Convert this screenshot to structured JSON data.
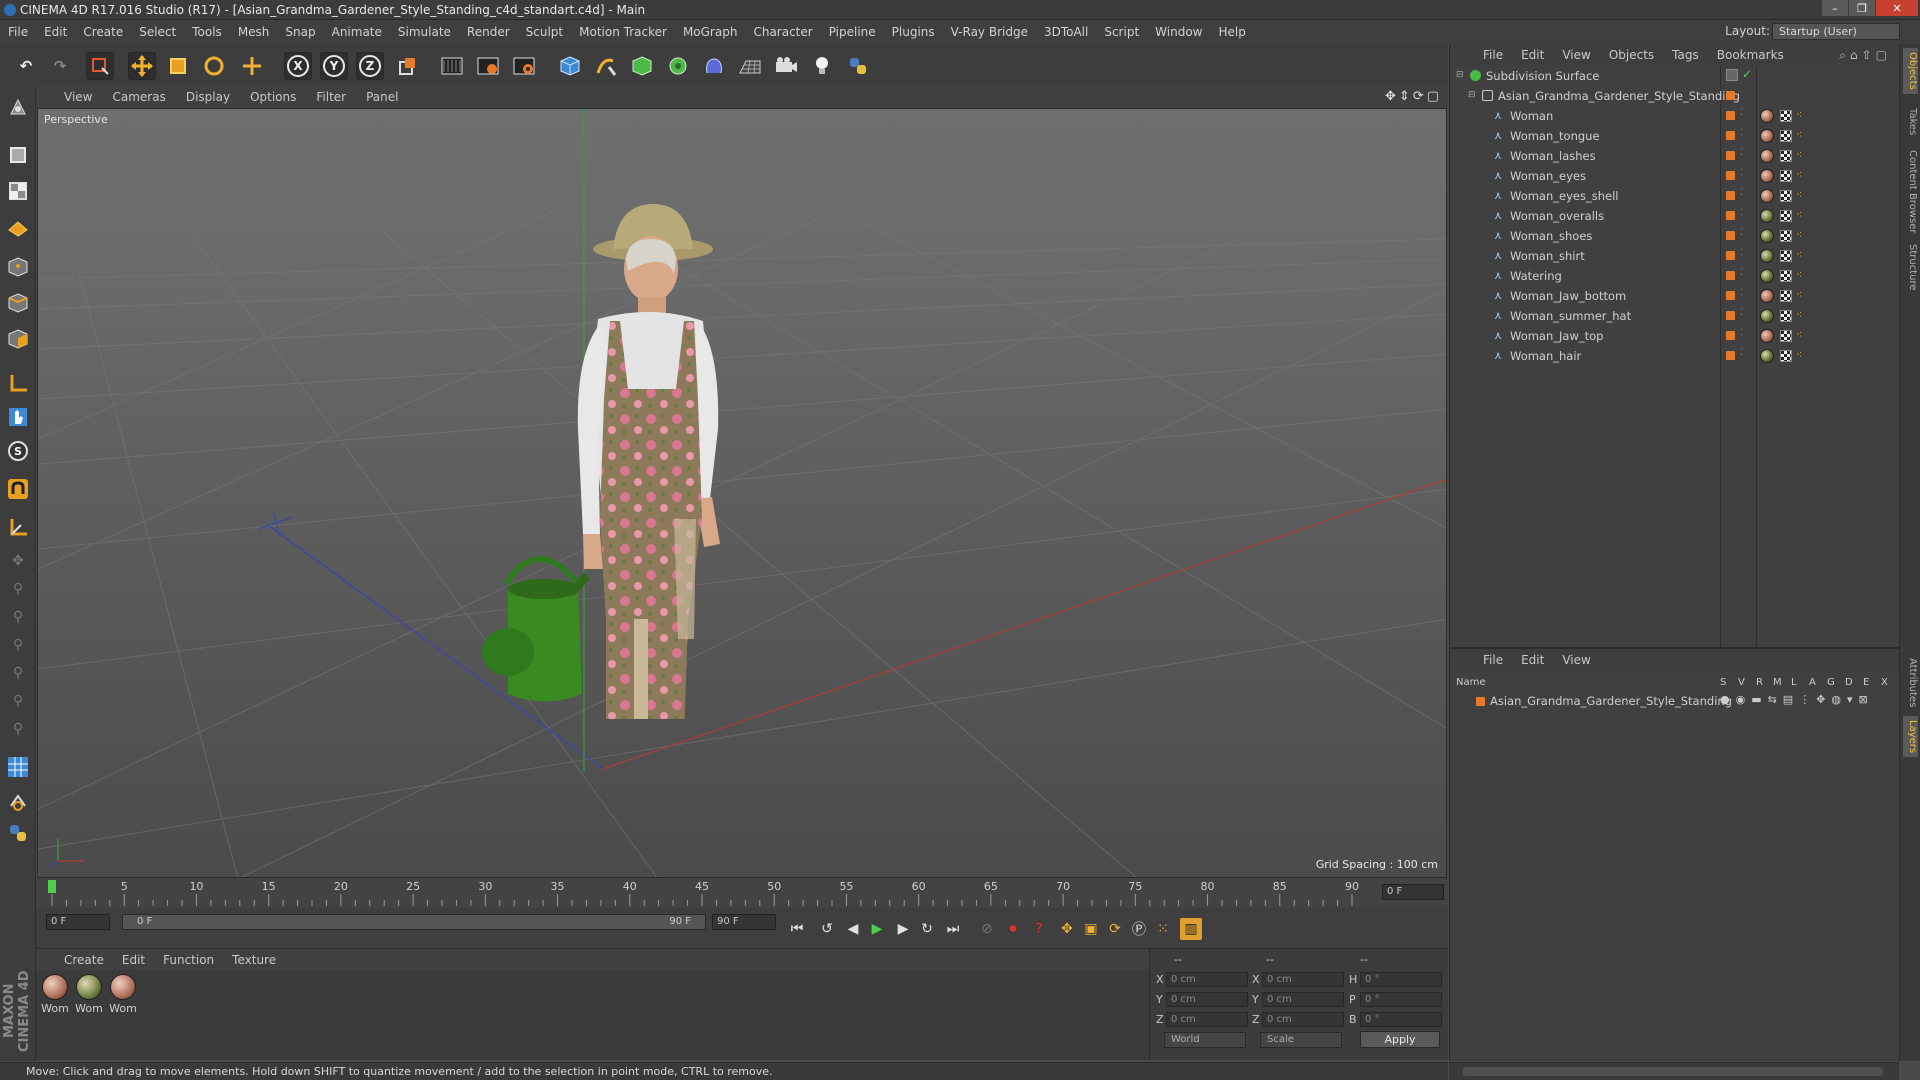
{
  "window": {
    "title": "CINEMA 4D R17.016 Studio (R17) - [Asian_Grandma_Gardener_Style_Standing_c4d_standart.c4d] - Main",
    "controls": [
      "–",
      "❐",
      "✕"
    ]
  },
  "menubar": {
    "items": [
      "File",
      "Edit",
      "Create",
      "Select",
      "Tools",
      "Mesh",
      "Snap",
      "Animate",
      "Simulate",
      "Render",
      "Sculpt",
      "Motion Tracker",
      "MoGraph",
      "Character",
      "Pipeline",
      "Plugins",
      "V-Ray Bridge",
      "3DToAll",
      "Script",
      "Window",
      "Help"
    ],
    "layout_label": "Layout:",
    "layout_value": "Startup (User)"
  },
  "toolbar": {
    "axis_x": "X",
    "axis_y": "Y",
    "axis_z": "Z"
  },
  "viewport": {
    "menu": [
      "View",
      "Cameras",
      "Display",
      "Options",
      "Filter",
      "Panel"
    ],
    "label": "Perspective",
    "grid_spacing": "Grid Spacing : 100 cm"
  },
  "timeline": {
    "ticks": [
      "0",
      "5",
      "10",
      "15",
      "20",
      "25",
      "30",
      "35",
      "40",
      "45",
      "50",
      "55",
      "60",
      "65",
      "70",
      "75",
      "80",
      "85",
      "90"
    ],
    "current_frame": "0 F",
    "start_field": "0 F",
    "range_start": "0 F",
    "range_end": "90 F",
    "end_field": "90 F"
  },
  "material_manager": {
    "menu": [
      "Create",
      "Edit",
      "Function",
      "Texture"
    ],
    "materials": [
      "Wom",
      "Wom",
      "Wom"
    ]
  },
  "coordinates": {
    "headers": [
      "--",
      "--",
      "--"
    ],
    "rows": [
      {
        "a": "X",
        "av": "0 cm",
        "b": "X",
        "bv": "0 cm",
        "c": "H",
        "cv": "0 °"
      },
      {
        "a": "Y",
        "av": "0 cm",
        "b": "Y",
        "bv": "0 cm",
        "c": "P",
        "cv": "0 °"
      },
      {
        "a": "Z",
        "av": "0 cm",
        "b": "Z",
        "bv": "0 cm",
        "c": "B",
        "cv": "0 °"
      }
    ],
    "world": "World",
    "scale": "Scale",
    "apply": "Apply"
  },
  "status": "Move: Click and drag to move elements. Hold down SHIFT to quantize movement / add to the selection in point mode, CTRL to remove.",
  "object_manager": {
    "menu": [
      "File",
      "Edit",
      "View",
      "Objects",
      "Tags",
      "Bookmarks"
    ],
    "root": "Subdivision Surface",
    "group": "Asian_Grandma_Gardener_Style_Standing",
    "objects": [
      "Woman",
      "Woman_tongue",
      "Woman_lashes",
      "Woman_eyes",
      "Woman_eyes_shell",
      "Woman_overalls",
      "Woman_shoes",
      "Woman_shirt",
      "Watering",
      "Woman_Jaw_bottom",
      "Woman_summer_hat",
      "Woman_Jaw_top",
      "Woman_hair"
    ]
  },
  "layer_manager": {
    "menu": [
      "File",
      "Edit",
      "View"
    ],
    "name_header": "Name",
    "columns": [
      "S",
      "V",
      "R",
      "M",
      "L",
      "A",
      "G",
      "D",
      "E",
      "X"
    ],
    "layer": "Asian_Grandma_Gardener_Style_Standing"
  },
  "side_tabs": [
    "Objects",
    "Takes",
    "Content Browser",
    "Structure",
    "Attributes",
    "Layers"
  ],
  "brand": "MAXON CINEMA 4D"
}
